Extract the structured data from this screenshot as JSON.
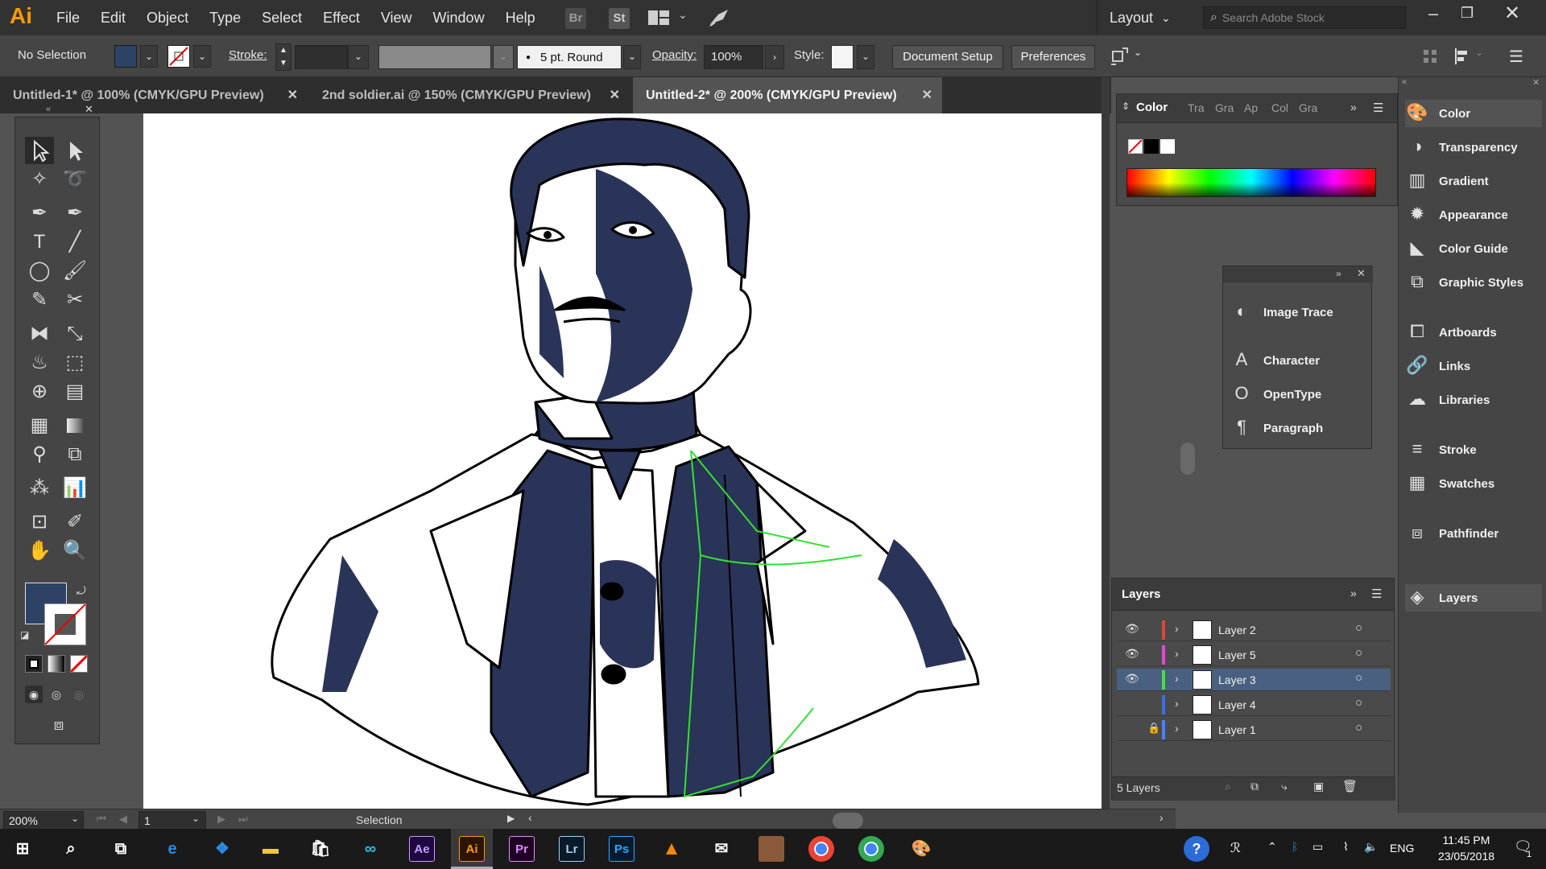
{
  "app": {
    "logo": "Ai"
  },
  "menu": [
    "File",
    "Edit",
    "Object",
    "Type",
    "Select",
    "Effect",
    "View",
    "Window",
    "Help"
  ],
  "bridge_icons": {
    "br": "Br",
    "st": "St"
  },
  "top_right": {
    "workspace": "Layout",
    "search_placeholder": "Search Adobe Stock"
  },
  "control": {
    "selection": "No Selection",
    "stroke_label": "Stroke:",
    "brush": "5 pt. Round",
    "opacity_label": "Opacity:",
    "opacity_value": "100%",
    "style_label": "Style:",
    "doc_setup": "Document Setup",
    "preferences": "Preferences",
    "fill_color": "#2e4266"
  },
  "tabs": [
    {
      "label": "Untitled-1* @ 100% (CMYK/GPU Preview)",
      "active": false
    },
    {
      "label": "2nd soldier.ai @ 150% (CMYK/GPU Preview)",
      "active": false
    },
    {
      "label": "Untitled-2* @ 200% (CMYK/GPU Preview)",
      "active": true
    }
  ],
  "color_panel": {
    "tabs": [
      "Color",
      "Tra",
      "Gra",
      "Ap",
      "Col",
      "Gra"
    ]
  },
  "float_panel": {
    "items": [
      "Image Trace",
      "Character",
      "OpenType",
      "Paragraph"
    ]
  },
  "dock": {
    "items": [
      "Color",
      "Transparency",
      "Gradient",
      "Appearance",
      "Color Guide",
      "Graphic Styles",
      "Artboards",
      "Links",
      "Libraries",
      "Stroke",
      "Swatches",
      "Pathfinder",
      "Layers"
    ]
  },
  "layers_panel": {
    "title": "Layers",
    "footer": "5 Layers",
    "rows": [
      {
        "name": "Layer 2",
        "visible": true,
        "locked": false,
        "color": "#e0453a",
        "selected": false
      },
      {
        "name": "Layer 5",
        "visible": true,
        "locked": false,
        "color": "#e14ad5",
        "selected": false
      },
      {
        "name": "Layer 3",
        "visible": true,
        "locked": false,
        "color": "#4bdc4b",
        "selected": true
      },
      {
        "name": "Layer 4",
        "visible": false,
        "locked": false,
        "color": "#3a6cf0",
        "selected": false
      },
      {
        "name": "Layer 1",
        "visible": false,
        "locked": true,
        "color": "#4a80ff",
        "selected": false
      }
    ]
  },
  "status": {
    "zoom": "200%",
    "artboard": "1",
    "tool": "Selection"
  },
  "taskbar": {
    "apps": [
      "Ae",
      "Ai",
      "Pr",
      "Lr",
      "Ps"
    ],
    "lang": "ENG",
    "time": "11:45 PM",
    "date": "23/05/2018",
    "notifications": "1"
  }
}
